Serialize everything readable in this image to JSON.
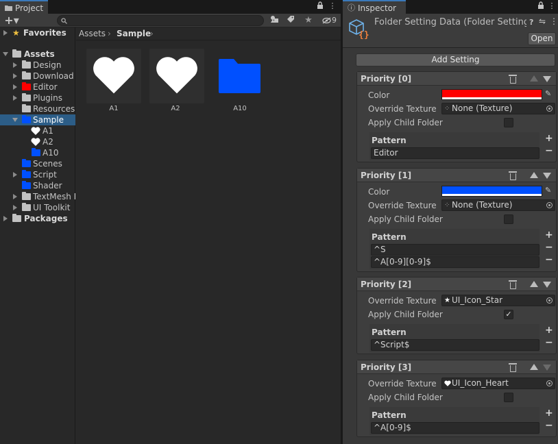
{
  "project": {
    "tab_label": "Project",
    "hidden_count": "9",
    "tree": [
      {
        "label": "Favorites",
        "bold": true
      },
      {
        "label": "Assets",
        "bold": true
      },
      {
        "label": "Design"
      },
      {
        "label": "Download"
      },
      {
        "label": "Editor"
      },
      {
        "label": "Plugins"
      },
      {
        "label": "Resources"
      },
      {
        "label": "Sample"
      },
      {
        "label": "A1"
      },
      {
        "label": "A2"
      },
      {
        "label": "A10"
      },
      {
        "label": "Scenes"
      },
      {
        "label": "Script"
      },
      {
        "label": "Shader"
      },
      {
        "label": "TextMesh Pro"
      },
      {
        "label": "UI Toolkit"
      },
      {
        "label": "Packages",
        "bold": true
      }
    ],
    "breadcrumb": {
      "root": "Assets",
      "current": "Sample"
    },
    "assets": [
      {
        "label": "A1",
        "icon": "heart-icon"
      },
      {
        "label": "A2",
        "icon": "heart-icon"
      },
      {
        "label": "A10",
        "icon": "folder-icon"
      }
    ]
  },
  "inspector": {
    "tab_label": "Inspector",
    "title": "Folder Setting Data (Folder Setting",
    "open_label": "Open",
    "add_setting_label": "Add Setting",
    "sections": [
      {
        "title": "Priority [0]",
        "color_label": "Color",
        "color": "#ff0000",
        "override_label": "Override Texture",
        "override_value": "None (Texture)",
        "apply_label": "Apply Child Folder",
        "apply_checked": false,
        "pattern_label": "Pattern",
        "patterns": [
          "Editor"
        ]
      },
      {
        "title": "Priority [1]",
        "color_label": "Color",
        "color": "#0050ff",
        "override_label": "Override Texture",
        "override_value": "None (Texture)",
        "apply_label": "Apply Child Folder",
        "apply_checked": false,
        "pattern_label": "Pattern",
        "patterns": [
          "^S",
          "^A[0-9][0-9]$"
        ]
      },
      {
        "title": "Priority [2]",
        "override_label": "Override Texture",
        "override_value": "UI_Icon_Star",
        "apply_label": "Apply Child Folder",
        "apply_checked": true,
        "apply_mark": "✓",
        "pattern_label": "Pattern",
        "patterns": [
          "^Script$"
        ]
      },
      {
        "title": "Priority [3]",
        "override_label": "Override Texture",
        "override_value": "UI_Icon_Heart",
        "apply_label": "Apply Child Folder",
        "apply_checked": false,
        "pattern_label": "Pattern",
        "patterns": [
          "^A[0-9]$"
        ]
      }
    ]
  },
  "colors": {
    "folder_gray": "#c2c2c2",
    "folder_red": "#ff0000",
    "folder_blue": "#0050ff",
    "selection": "#2c5d87"
  }
}
